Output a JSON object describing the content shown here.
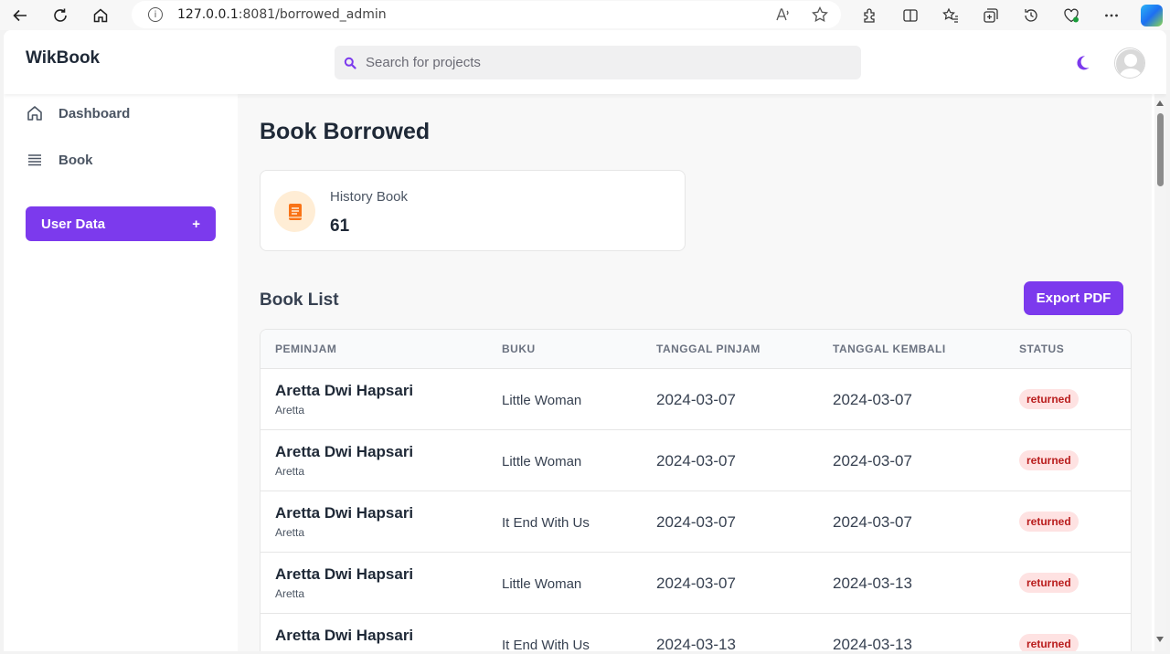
{
  "browser": {
    "url_host": "127.0.0.1",
    "url_rest": ":8081/borrowed_admin"
  },
  "header": {
    "brand": "WikBook",
    "search_placeholder": "Search for projects",
    "search_value": ""
  },
  "sidebar": {
    "items": [
      {
        "label": "Dashboard",
        "icon": "home-icon"
      },
      {
        "label": "Book",
        "icon": "list-icon"
      }
    ],
    "user_data_label": "User Data",
    "user_data_plus": "+"
  },
  "main": {
    "title": "Book Borrowed",
    "stat": {
      "label": "History Book",
      "value": "61",
      "icon": "book-icon",
      "color": "#f97316"
    },
    "section_title": "Book List",
    "export_label": "Export PDF",
    "columns": [
      "PEMINJAM",
      "BUKU",
      "TANGGAL PINJAM",
      "TANGGAL KEMBALI",
      "STATUS"
    ],
    "rows": [
      {
        "name": "Aretta Dwi Hapsari",
        "username": "Aretta",
        "book": "Little Woman",
        "borrow_date": "2024-03-07",
        "return_date": "2024-03-07",
        "status": "returned"
      },
      {
        "name": "Aretta Dwi Hapsari",
        "username": "Aretta",
        "book": "Little Woman",
        "borrow_date": "2024-03-07",
        "return_date": "2024-03-07",
        "status": "returned"
      },
      {
        "name": "Aretta Dwi Hapsari",
        "username": "Aretta",
        "book": "It End With Us",
        "borrow_date": "2024-03-07",
        "return_date": "2024-03-07",
        "status": "returned"
      },
      {
        "name": "Aretta Dwi Hapsari",
        "username": "Aretta",
        "book": "Little Woman",
        "borrow_date": "2024-03-07",
        "return_date": "2024-03-13",
        "status": "returned"
      },
      {
        "name": "Aretta Dwi Hapsari",
        "username": "",
        "book": "It End With Us",
        "borrow_date": "2024-03-13",
        "return_date": "2024-03-13",
        "status": "returned"
      }
    ]
  },
  "colors": {
    "accent": "#7c3aed",
    "status_bg": "#fee2e2",
    "status_text": "#b91c1c"
  }
}
